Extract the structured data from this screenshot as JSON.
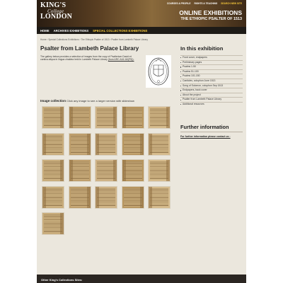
{
  "header": {
    "logo_line1": "KING'S",
    "logo_line2": "College",
    "logo_line3": "LONDON",
    "top_links": [
      "COURSES & PROFILE",
      "RIGHTS & TEACHING",
      "SEARCH NEW SITE"
    ],
    "exhibition_title": "ONLINE EXHIBITIONS",
    "exhibition_subtitle": "THE ETHIOPIC PSALTER OF 1513"
  },
  "nav": {
    "items": [
      "HOME",
      "ARCHIVES EXHIBITIONS",
      "SPECIAL COLLECTIONS EXHIBITIONS"
    ]
  },
  "breadcrumb": "Home  ›  Special Collections Exhibitions  ›  The Ethiopic Psalter of 1513  ›  Psalter from Lambeth Palace Library",
  "main": {
    "title": "Psalter from Lambeth Palace Library",
    "intro": "The gallery below provides a selection of images from the copy of Psalterium David et cantica aliqua in lingua chaldea held in Lambeth Palace Library",
    "intro_link": "(from ARC A16.16/(P5)).",
    "gallery_title": "Image collection",
    "gallery_hint": "Click any image to see a larger version with slideshow"
  },
  "sidebar": {
    "title": "In this exhibition",
    "items": [
      "Front cover, endpapers",
      "Preliminary pages",
      "Psalms 1-50",
      "Psalms 51-100",
      "Psalms 101-150",
      "Canticles, colophon June 1513",
      "Song of Solomon, colophon Sep 1513",
      "Endpapers, back cover",
      "About the project",
      "Psalter from Lambeth Palace Library",
      "Additional resources"
    ],
    "further_title": "Further information",
    "further_link": "For further information please contact us :"
  },
  "footer": {
    "label": "Other King's Collections Sites:"
  },
  "colors": {
    "nav_bg": "#1e1b17",
    "accent": "#f6c83b",
    "content_bg": "#ebe7dd"
  },
  "thumbnail_count": 21
}
